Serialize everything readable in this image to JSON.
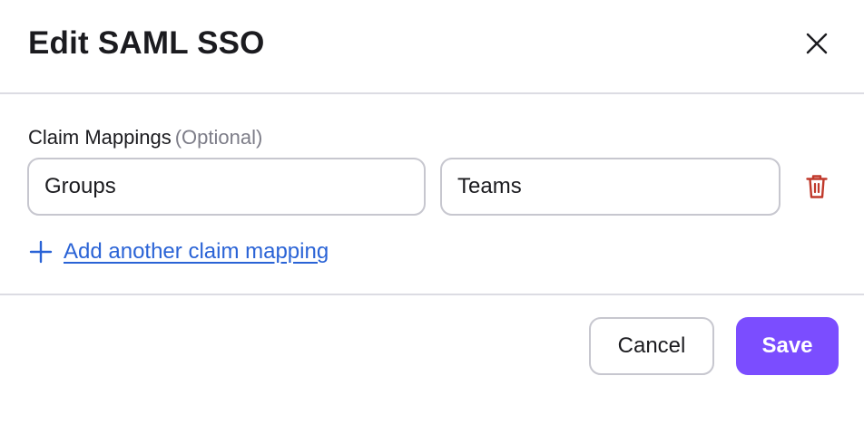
{
  "dialog": {
    "title": "Edit SAML SSO",
    "close_icon": "close-icon"
  },
  "claim_mappings": {
    "label": "Claim Mappings",
    "optional_label": "(Optional)",
    "rows": [
      {
        "claim": "Groups",
        "value": "Teams",
        "delete_icon": "trash-icon"
      }
    ],
    "add_link": "Add another claim mapping",
    "add_icon": "plus-icon"
  },
  "footer": {
    "cancel_label": "Cancel",
    "save_label": "Save"
  },
  "colors": {
    "accent": "#7b4dff",
    "link": "#2a63d6",
    "danger": "#c0392b",
    "border": "#c7c7cf"
  }
}
